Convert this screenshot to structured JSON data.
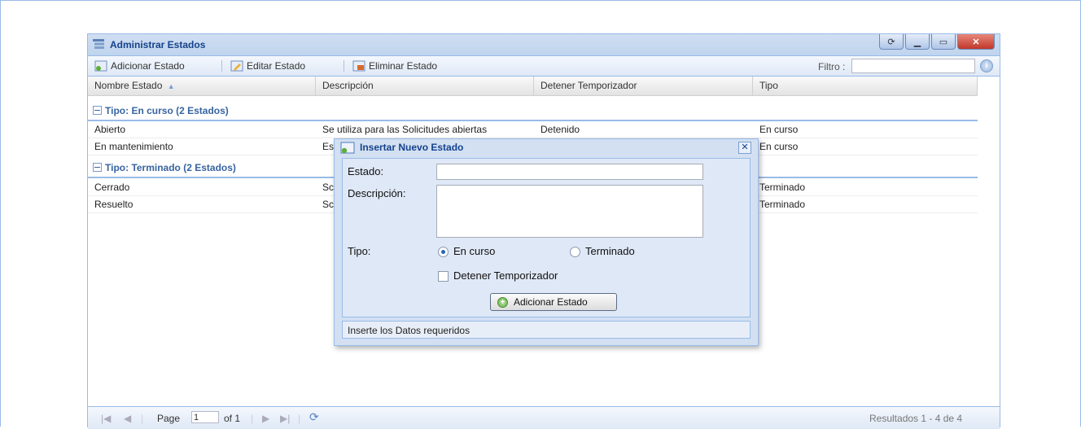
{
  "window": {
    "title": "Administrar Estados"
  },
  "toolbar": {
    "add_label": "Adicionar Estado",
    "edit_label": "Editar Estado",
    "delete_label": "Eliminar Estado",
    "filter_label": "Filtro :",
    "filter_value": ""
  },
  "columns": [
    "Nombre Estado",
    "Descripción",
    "Detener Temporizador",
    "Tipo"
  ],
  "groups": [
    {
      "label": "Tipo: En curso (2 Estados)",
      "rows": [
        {
          "name": "Abierto",
          "description": "Se utiliza para las Solicitudes abiertas",
          "timer": "Detenido",
          "type": "En curso"
        },
        {
          "name": "En mantenimiento",
          "description": "Es",
          "timer": "",
          "type": "En curso"
        }
      ]
    },
    {
      "label": "Tipo: Terminado (2 Estados)",
      "rows": [
        {
          "name": "Cerrado",
          "description": "Sc",
          "timer": "",
          "type": "Terminado"
        },
        {
          "name": "Resuelto",
          "description": "Sc",
          "timer": "",
          "type": "Terminado"
        }
      ]
    }
  ],
  "pager": {
    "page_label": "Page",
    "page_value": "1",
    "of_label": "of 1",
    "results": "Resultados 1 - 4 de 4"
  },
  "dialog": {
    "title": "Insertar Nuevo Estado",
    "estado_label": "Estado:",
    "estado_value": "",
    "descripcion_label": "Descripción:",
    "descripcion_value": "",
    "tipo_label": "Tipo:",
    "radio_en_curso": "En curso",
    "radio_terminado": "Terminado",
    "selected_tipo": "En curso",
    "checkbox_label": "Detener Temporizador",
    "checkbox_checked": false,
    "add_button": "Adicionar Estado",
    "status": "Inserte los Datos requeridos"
  },
  "colors": {
    "accent": "#15428b",
    "border": "#99bbe8",
    "header_bg": "#d0def2"
  }
}
